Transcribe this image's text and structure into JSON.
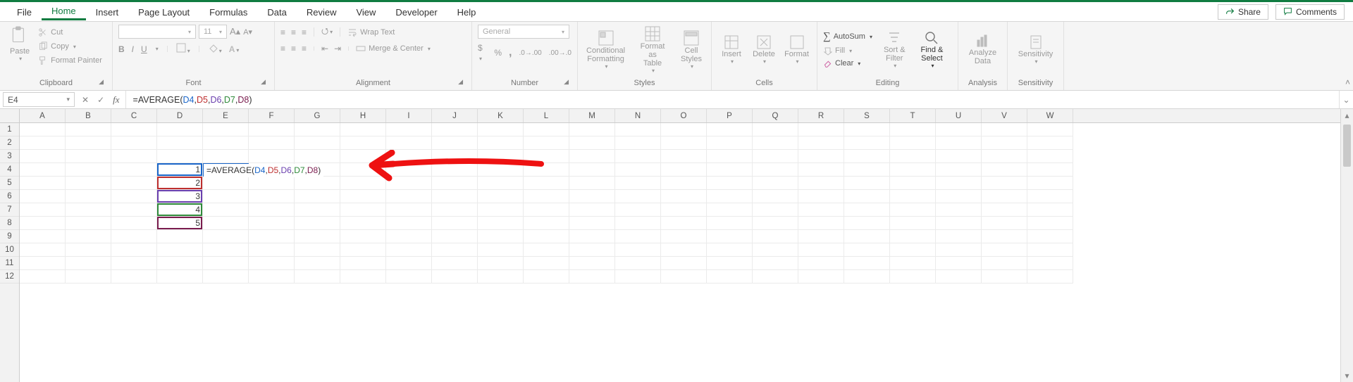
{
  "tabs": {
    "items": [
      "File",
      "Home",
      "Insert",
      "Page Layout",
      "Formulas",
      "Data",
      "Review",
      "View",
      "Developer",
      "Help"
    ],
    "active_index": 1,
    "share": "Share",
    "comments": "Comments"
  },
  "ribbon": {
    "clipboard": {
      "paste": "Paste",
      "cut": "Cut",
      "copy": "Copy",
      "format_painter": "Format Painter",
      "label": "Clipboard"
    },
    "font": {
      "font_name": "",
      "font_size": "11",
      "bold": "B",
      "italic": "I",
      "underline": "U",
      "label": "Font"
    },
    "alignment": {
      "wrap_text": "Wrap Text",
      "merge_center": "Merge & Center",
      "label": "Alignment"
    },
    "number": {
      "format": "General",
      "currency": "$",
      "percent": "%",
      "comma": ",",
      "label": "Number"
    },
    "styles": {
      "conditional": "Conditional\nFormatting",
      "format_table": "Format as\nTable",
      "cell_styles": "Cell\nStyles",
      "label": "Styles"
    },
    "cells": {
      "insert": "Insert",
      "delete": "Delete",
      "format": "Format",
      "label": "Cells"
    },
    "editing": {
      "autosum": "AutoSum",
      "fill": "Fill",
      "clear": "Clear",
      "sort_filter": "Sort &\nFilter",
      "find_select": "Find &\nSelect",
      "label": "Editing"
    },
    "analysis": {
      "analyze": "Analyze\nData",
      "label": "Analysis"
    },
    "sensitivity": {
      "sensitivity": "Sensitivity",
      "label": "Sensitivity"
    }
  },
  "formula_bar": {
    "cell_ref": "E4",
    "formula": "=AVERAGE(D4,D5,D6,D7,D8)"
  },
  "grid": {
    "columns": [
      "A",
      "B",
      "C",
      "D",
      "E",
      "F",
      "G",
      "H",
      "I",
      "J",
      "K",
      "L",
      "M",
      "N",
      "O",
      "P",
      "Q",
      "R",
      "S",
      "T",
      "U",
      "V",
      "W"
    ],
    "row_count": 12,
    "cells": {
      "D4": "1",
      "D5": "2",
      "D6": "3",
      "D7": "4",
      "D8": "5"
    },
    "editing": {
      "address": "E4",
      "prefix": "=AVERAGE(",
      "refs": [
        "D4",
        "D5",
        "D6",
        "D7",
        "D8"
      ],
      "suffix": ")"
    }
  }
}
